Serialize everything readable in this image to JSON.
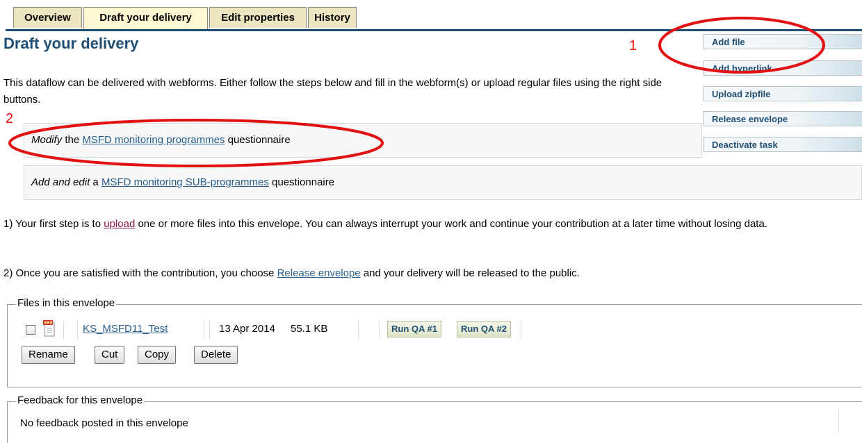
{
  "tabs": [
    {
      "label": "Overview"
    },
    {
      "label": "Draft your delivery",
      "active": true
    },
    {
      "label": "Edit properties"
    },
    {
      "label": "History"
    }
  ],
  "page_title": "Draft your delivery",
  "intro_text": "This dataflow can be delivered with webforms. Either follow the steps below and fill in the webform(s) or upload regular files using the right side buttons.",
  "side_buttons": {
    "add_file": "Add file",
    "add_hyperlink": "Add hyperlink",
    "upload_zipfile": "Upload zipfile",
    "release_envelope": "Release envelope",
    "deactivate_task": "Deactivate task"
  },
  "questionnaires": {
    "q1_action": "Modify",
    "q1_pre": " the ",
    "q1_link": "MSFD monitoring programmes",
    "q1_post": " questionnaire",
    "q2_action": "Add and edit",
    "q2_pre": " a ",
    "q2_link": "MSFD monitoring SUB-programmes",
    "q2_post": " questionnaire"
  },
  "steps": {
    "s1_pre": "1) Your first step is to ",
    "s1_link": "upload",
    "s1_post": " one or more files into this envelope. You can always interrupt your work and continue your contribution at a later time without losing data.",
    "s2_pre": "2) Once you are satisfied with the contribution, you choose ",
    "s2_link": "Release envelope",
    "s2_post": " and your delivery will be released to the public."
  },
  "files_section": {
    "legend": "Files in this envelope",
    "file": {
      "name": "KS_MSFD11_Test",
      "date": "13 Apr 2014",
      "size": "55.1 KB",
      "qa1": "Run QA #1",
      "qa2": "Run QA #2"
    },
    "actions": {
      "rename": "Rename",
      "cut": "Cut",
      "copy": "Copy",
      "delete": "Delete"
    }
  },
  "feedback_section": {
    "legend": "Feedback for this envelope",
    "text": "No feedback posted in this envelope"
  },
  "annotations": {
    "label_1": "1",
    "label_2": "2",
    "color": "#e11111"
  },
  "colors": {
    "title": "#1e4e73",
    "link": "#275d8b",
    "visited_link": "#8a1747",
    "tab_bg": "#ebe6bf"
  }
}
